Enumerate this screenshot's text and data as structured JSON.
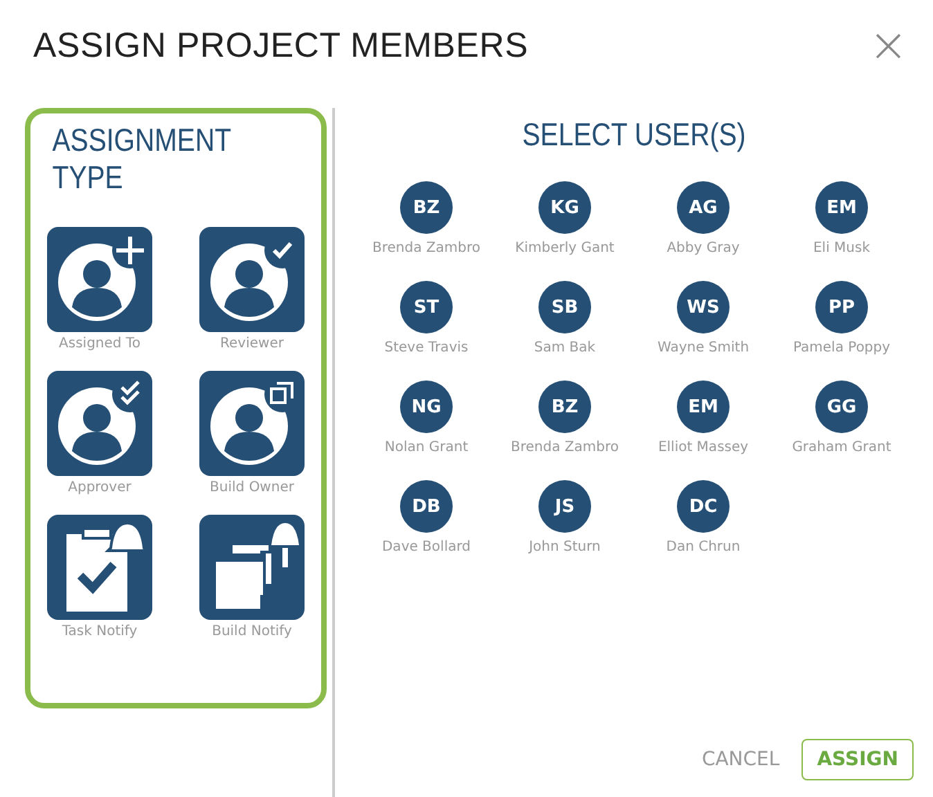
{
  "dialog": {
    "title": "ASSIGN PROJECT MEMBERS",
    "close": "×"
  },
  "assignment_type": {
    "heading": "ASSIGNMENT TYPE",
    "types": [
      {
        "label": "Assigned To",
        "kind": "add"
      },
      {
        "label": "Reviewer",
        "kind": "check"
      },
      {
        "label": "Approver",
        "kind": "double-check"
      },
      {
        "label": "Build Owner",
        "kind": "copy"
      },
      {
        "label": "Task Notify",
        "kind": "task-bell"
      },
      {
        "label": "Build Notify",
        "kind": "build-bell"
      }
    ]
  },
  "users": {
    "heading": "SELECT USER(S)",
    "items": [
      {
        "initials": "BZ",
        "name": "Brenda Zambro"
      },
      {
        "initials": "KG",
        "name": "Kimberly Gant"
      },
      {
        "initials": "AG",
        "name": "Abby Gray"
      },
      {
        "initials": "EM",
        "name": "Eli Musk"
      },
      {
        "initials": "ST",
        "name": "Steve Travis"
      },
      {
        "initials": "SB",
        "name": "Sam Bak"
      },
      {
        "initials": "WS",
        "name": "Wayne Smith"
      },
      {
        "initials": "PP",
        "name": "Pamela Poppy"
      },
      {
        "initials": "NG",
        "name": "Nolan Grant"
      },
      {
        "initials": "BZ",
        "name": "Brenda Zambro"
      },
      {
        "initials": "EM",
        "name": "Elliot Massey"
      },
      {
        "initials": "GG",
        "name": "Graham Grant"
      },
      {
        "initials": "DB",
        "name": "Dave Bollard"
      },
      {
        "initials": "JS",
        "name": "John Sturn"
      },
      {
        "initials": "DC",
        "name": "Dan Chrun"
      }
    ]
  },
  "buttons": {
    "cancel": "CANCEL",
    "assign": "ASSIGN"
  }
}
